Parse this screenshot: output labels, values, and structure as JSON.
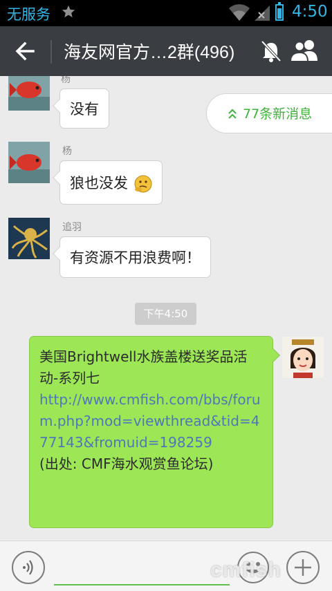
{
  "status_bar": {
    "carrier": "无服务",
    "time": "4:50",
    "icons": [
      "star-icon",
      "wifi-icon",
      "no-signal-icon",
      "battery-icon"
    ],
    "battery_level": 0.75
  },
  "app_bar": {
    "title": "海友网官方…2群(496)",
    "icons": [
      "back-arrow-icon",
      "mute-bell-icon",
      "group-members-icon"
    ]
  },
  "new_messages": {
    "label": "77条新消息",
    "icon": "double-chevron-up-icon"
  },
  "messages": [
    {
      "sender": "杨",
      "text": "没有",
      "avatar": "red-fish-avatar"
    },
    {
      "sender": "杨",
      "text": "狼也没发",
      "emoji": "thinking-emoji",
      "avatar": "red-fish-avatar"
    },
    {
      "sender": "追羽",
      "text": "有资源不用浪费啊！",
      "avatar": "octopus-avatar"
    }
  ],
  "time_divider": "下午4:50",
  "outgoing_message": {
    "line1": "美国Brightwell水族盖楼送奖品活动-系列七",
    "link": "http://www.cmfish.com/bbs/forum.php?mod=viewthread&tid=477143&fromuid=198259",
    "source": "(出处: CMF海水观赏鱼论坛)",
    "avatar": "cartoon-girl-avatar"
  },
  "input_bar": {
    "placeholder": "",
    "icons": [
      "voice-icon",
      "emoji-icon",
      "plus-icon"
    ]
  },
  "watermark": "cmfish",
  "colors": {
    "accent_green": "#3fb23b",
    "bubble_green": "#9de756",
    "link_blue": "#4d77b8",
    "statusbar_blue": "#33b5e5",
    "appbar_bg": "#3a3e42"
  }
}
